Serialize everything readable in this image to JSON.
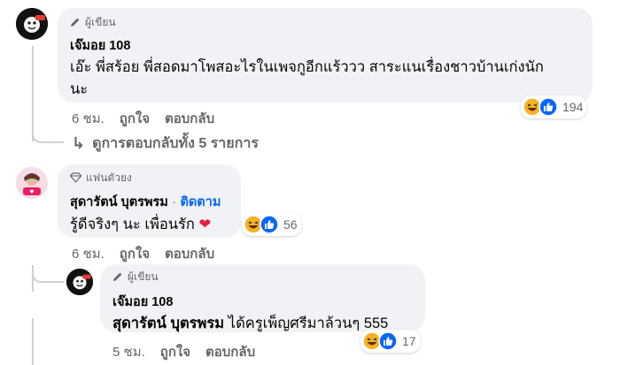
{
  "comment1": {
    "badge": "ผู้เขียน",
    "author": "เจ๊มอย 108",
    "text_line1": "เอ๊ะ พี่สร้อย พี่สอดมาโพสอะไรในเพจกูอีกแร้ววว สาระแนเรื่องชาวบ้านเก่งนัก",
    "text_line2": "นะ",
    "time": "6 ชม.",
    "like": "ถูกใจ",
    "reply": "ตอบกลับ",
    "reaction_count": "194",
    "view_replies": "ดูการตอบกลับทั้ง 5 รายการ"
  },
  "comment2": {
    "badge": "แฟนตัวยง",
    "author": "สุดารัตน์ บุตรพรม",
    "separator": "·",
    "follow": "ติดตาม",
    "text": "รู้ดีจริงๆ นะ เพื่อนรัก",
    "time": "6 ชม.",
    "like": "ถูกใจ",
    "reply": "ตอบกลับ",
    "reaction_count": "56"
  },
  "comment3": {
    "badge": "ผู้เขียน",
    "author": "เจ๊มอย 108",
    "mention": "สุดารัตน์ บุตรพรม",
    "text": "ได้ครูเพ็ญศรีมาล้วนๆ 555",
    "time": "5 ชม.",
    "like": "ถูกใจ",
    "reply": "ตอบกลับ",
    "reaction_count": "17"
  },
  "colors": {
    "bubble": "#f0f2f5",
    "muted": "#65676b",
    "link": "#0866ff",
    "like_blue": "#0866ff",
    "haha_yellow": "#f7b125"
  }
}
